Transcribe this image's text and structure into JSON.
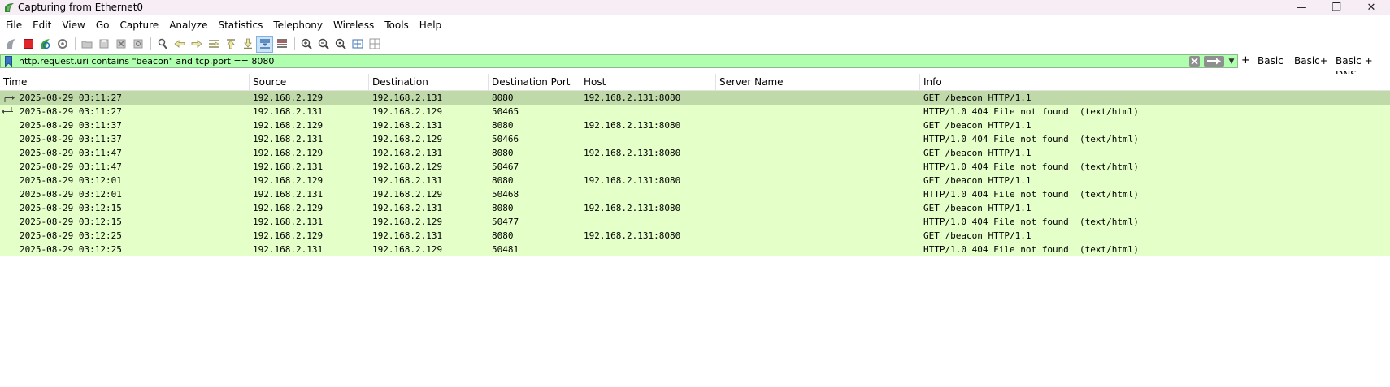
{
  "window": {
    "title": "Capturing from Ethernet0",
    "minimize_glyph": "—",
    "maximize_glyph": "❐",
    "close_glyph": "✕"
  },
  "menu": [
    "File",
    "Edit",
    "View",
    "Go",
    "Capture",
    "Analyze",
    "Statistics",
    "Telephony",
    "Wireless",
    "Tools",
    "Help"
  ],
  "toolbar": {
    "icons": [
      "start-capture-icon",
      "stop-capture-icon",
      "restart-capture-icon",
      "capture-options-icon",
      "open-file-icon",
      "save-file-icon",
      "close-file-icon",
      "reload-file-icon",
      "find-packet-icon",
      "go-back-icon",
      "go-forward-icon",
      "go-to-packet-icon",
      "go-first-packet-icon",
      "go-last-packet-icon",
      "autoscroll-icon",
      "colorize-icon",
      "zoom-in-icon",
      "zoom-out-icon",
      "zoom-normal-icon",
      "resize-columns-icon",
      "layout-icon"
    ]
  },
  "filter": {
    "value": "http.request.uri contains \"beacon\" and tcp.port == 8080",
    "plus": "+",
    "buttons": [
      "Basic",
      "Basic+",
      "Basic + DNS"
    ],
    "bg_color": "#afffaf"
  },
  "packet_list": {
    "columns": [
      "Time",
      "Source",
      "Destination",
      "Destination Port",
      "Host",
      "Server Name",
      "Info"
    ],
    "row_color": "#e4ffc7",
    "selected_color": "#bfd9a8",
    "rows": [
      {
        "time": "2025-08-29 03:11:27",
        "source": "192.168.2.129",
        "destination": "192.168.2.131",
        "dport": "8080",
        "host": "192.168.2.131:8080",
        "server": "",
        "info": "GET /beacon HTTP/1.1",
        "selected": true,
        "marker": "request"
      },
      {
        "time": "2025-08-29 03:11:27",
        "source": "192.168.2.131",
        "destination": "192.168.2.129",
        "dport": "50465",
        "host": "",
        "server": "",
        "info": "HTTP/1.0 404 File not found  (text/html)",
        "selected": false,
        "marker": "response"
      },
      {
        "time": "2025-08-29 03:11:37",
        "source": "192.168.2.129",
        "destination": "192.168.2.131",
        "dport": "8080",
        "host": "192.168.2.131:8080",
        "server": "",
        "info": "GET /beacon HTTP/1.1",
        "selected": false,
        "marker": ""
      },
      {
        "time": "2025-08-29 03:11:37",
        "source": "192.168.2.131",
        "destination": "192.168.2.129",
        "dport": "50466",
        "host": "",
        "server": "",
        "info": "HTTP/1.0 404 File not found  (text/html)",
        "selected": false,
        "marker": ""
      },
      {
        "time": "2025-08-29 03:11:47",
        "source": "192.168.2.129",
        "destination": "192.168.2.131",
        "dport": "8080",
        "host": "192.168.2.131:8080",
        "server": "",
        "info": "GET /beacon HTTP/1.1",
        "selected": false,
        "marker": ""
      },
      {
        "time": "2025-08-29 03:11:47",
        "source": "192.168.2.131",
        "destination": "192.168.2.129",
        "dport": "50467",
        "host": "",
        "server": "",
        "info": "HTTP/1.0 404 File not found  (text/html)",
        "selected": false,
        "marker": ""
      },
      {
        "time": "2025-08-29 03:12:01",
        "source": "192.168.2.129",
        "destination": "192.168.2.131",
        "dport": "8080",
        "host": "192.168.2.131:8080",
        "server": "",
        "info": "GET /beacon HTTP/1.1",
        "selected": false,
        "marker": ""
      },
      {
        "time": "2025-08-29 03:12:01",
        "source": "192.168.2.131",
        "destination": "192.168.2.129",
        "dport": "50468",
        "host": "",
        "server": "",
        "info": "HTTP/1.0 404 File not found  (text/html)",
        "selected": false,
        "marker": ""
      },
      {
        "time": "2025-08-29 03:12:15",
        "source": "192.168.2.129",
        "destination": "192.168.2.131",
        "dport": "8080",
        "host": "192.168.2.131:8080",
        "server": "",
        "info": "GET /beacon HTTP/1.1",
        "selected": false,
        "marker": ""
      },
      {
        "time": "2025-08-29 03:12:15",
        "source": "192.168.2.131",
        "destination": "192.168.2.129",
        "dport": "50477",
        "host": "",
        "server": "",
        "info": "HTTP/1.0 404 File not found  (text/html)",
        "selected": false,
        "marker": ""
      },
      {
        "time": "2025-08-29 03:12:25",
        "source": "192.168.2.129",
        "destination": "192.168.2.131",
        "dport": "8080",
        "host": "192.168.2.131:8080",
        "server": "",
        "info": "GET /beacon HTTP/1.1",
        "selected": false,
        "marker": ""
      },
      {
        "time": "2025-08-29 03:12:25",
        "source": "192.168.2.131",
        "destination": "192.168.2.129",
        "dport": "50481",
        "host": "",
        "server": "",
        "info": "HTTP/1.0 404 File not found  (text/html)",
        "selected": false,
        "marker": ""
      }
    ]
  }
}
